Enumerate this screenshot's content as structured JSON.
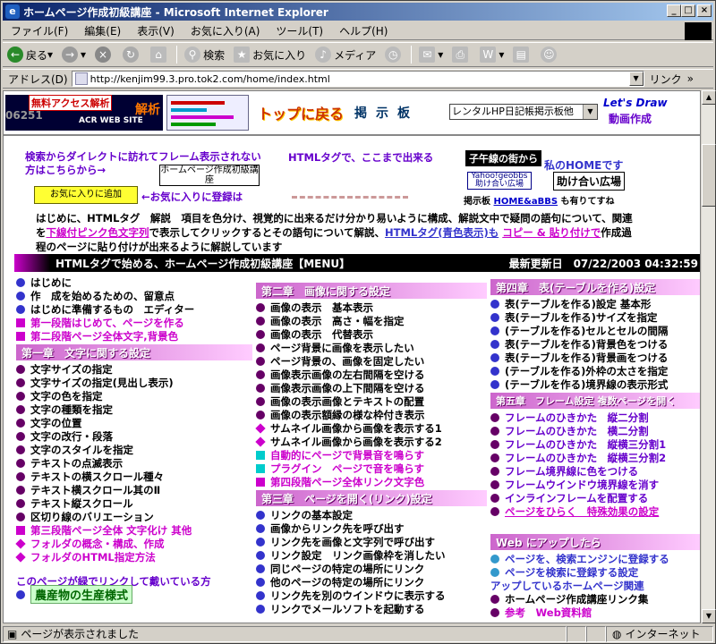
{
  "window": {
    "title": "ホームページ作成初級講座 - Microsoft Internet Explorer",
    "min": "_",
    "max": "□",
    "close": "×"
  },
  "menu": [
    "ファイル(F)",
    "編集(E)",
    "表示(V)",
    "お気に入り(A)",
    "ツール(T)",
    "ヘルプ(H)"
  ],
  "toolbar": {
    "back": "戻る",
    "search": "検索",
    "favorites": "お気に入り",
    "media": "メディア"
  },
  "address": {
    "label": "アドレス(D)",
    "url": "http://kenjim99.3.pro.tok2.com/home/index.html",
    "links": "リンク"
  },
  "status": {
    "text": "ページが表示されました",
    "zone": "インターネット"
  },
  "header": {
    "access": "無料アクセス解析",
    "counter": "06251",
    "acr": "ACR WEB SITE",
    "kaiseki": "解析",
    "top": "トップに戻る",
    "board": "掲示板",
    "select": "レンタルHP日記帳掲示板他",
    "letsdraw": "Let's Draw",
    "douga": "動画作成"
  },
  "intro": {
    "link1": "検索からダイレクトに訪れてフレーム表示されない方はこちらから→",
    "hpbox": "ホームページ作成初級講座",
    "htmltag": "HTMLタグで、ここまで出来る",
    "koyo": "子午線の街から",
    "myhome": "私のHOMEです",
    "yahoo": "Yahoo!geobbs 助け合い広場",
    "tasuke": "助け合い広場",
    "okini": "お気に入りに追加",
    "okini_txt": "←お気に入りに登録は",
    "keijiban_pre": "掲示板",
    "keijiban_link": "HOME&aBBS",
    "keijiban_post": "も有りてすね",
    "para1": "はじめに、HTMLタグ　解説　項目を色分け、視覚的に出来るだけ分かり易いように構成、解説文中で疑問の語句について、関連",
    "para2a": "を",
    "para2b": "下線付ピンク色文字列",
    "para2c": "で表示してクリックするとその語句について解説、",
    "para2d": "HTMLタグ(青色表示)も",
    "para2e": "コピー & 貼り付けで",
    "para2f": "作成過",
    "para3": "程のページに貼り付けが出来るように解説しています"
  },
  "menuhdr": {
    "title": "HTMLタグで始める、ホームページ作成初級講座【MENU】",
    "updated": "最新更新日　07/22/2003 04:32:59"
  },
  "col1": {
    "top": [
      "はじめに",
      "作　成を始めるための、留意点",
      "はじめに準備するもの　エディター"
    ],
    "pink": [
      "第一段階はじめて、ページを作る",
      "第二段階ページ全体文字,背景色"
    ],
    "ch1": "第一章　文字に関する設定",
    "ch1_items": [
      "文字サイズの指定",
      "文字サイズの指定(見出し表示)",
      "文字の色を指定",
      "文字の種類を指定",
      "文字の位置",
      "文字の改行・段落",
      "文字のスタイルを指定",
      "テキストの点滅表示",
      "テキストの横スクロール種々",
      "テキスト横スクロール其のⅡ",
      "テキスト縦スクロール",
      "区切り線のバリエーション"
    ],
    "ch1_pink": [
      "第三段階ページ全体 文字化け 其他",
      "フォルダの概念・構成、作成",
      "フォルダのHTML指定方法"
    ],
    "bottom": "このページが緑でリンクして戴いている方",
    "green": "農産物の生産様式"
  },
  "col2": {
    "ch2": "第二章　画像に関する設定",
    "ch2_items": [
      "画像の表示　基本表示",
      "画像の表示　高さ・幅を指定",
      "画像の表示　代替表示",
      "ページ背景に画像を表示したい",
      "ページ背景の、画像を固定したい",
      "画像表示画像の左右間隔を空ける",
      "画像表示画像の上下間隔を空ける",
      "画像の表示画像とテキストの配置",
      "画像の表示額縁の様な枠付き表示"
    ],
    "ch2_dm": [
      "サムネイル画像から画像を表示する1",
      "サムネイル画像から画像を表示する2"
    ],
    "ch2_cy": [
      "自動的にページで背景音を鳴らす",
      "プラグイン　ページで音を鳴らす"
    ],
    "ch2_pink": "第四段階ページ全体リンク文字色",
    "ch3": "第三章　ページを開く(リンク)設定",
    "ch3_items": [
      "リンクの基本設定",
      "画像からリンク先を呼び出す",
      "リンク先を画像と文字列で呼び出す",
      "リンク設定　リンク画像枠を消したい",
      "同じページの特定の場所にリンク",
      "他のページの特定の場所にリンク",
      "リンク先を別のウインドウに表示する",
      "リンクでメールソフトを起動する"
    ]
  },
  "col3": {
    "ch4": "第四章　表(テーブルを作る)設定",
    "ch4_items": [
      "表(テーブルを作る)設定 基本形",
      "表(テーブルを作る)サイズを指定",
      "(テーブルを作る)セルとセルの間隔",
      "表(テーブルを作る)背景色をつける",
      "表(テーブルを作る)背景画をつける",
      "(テーブルを作る)外枠の太さを指定",
      "(テーブルを作る)境界線の表示形式"
    ],
    "ch5": "第五章　フレーム設定 複数ページを開く",
    "ch5_items": [
      "フレームのひきかた　縦二分割",
      "フレームのひきかた　横二分割",
      "フレームのひきかた　縦横三分割1",
      "フレームのひきかた　縦横三分割2",
      "フレーム境界線に色をつける",
      "フレームウインドウ境界線を消す",
      "インラインフレームを配置する"
    ],
    "ch5_last": "ページをひらく　特殊効果の設定",
    "web": "Web にアップしたら",
    "web_items": [
      "ページを、検索エンジンに登録する",
      "ページを検索に登録する設定"
    ],
    "web_sub": "アップしているホームページ関連",
    "web_items2": [
      "ホームページ作成講座リンク集"
    ],
    "web_last": "参考　Web資料館"
  },
  "colors": {
    "blue_bullet": "#3333cc",
    "purple_bullet": "#660066",
    "chapter_grad": "#cc66cc"
  }
}
